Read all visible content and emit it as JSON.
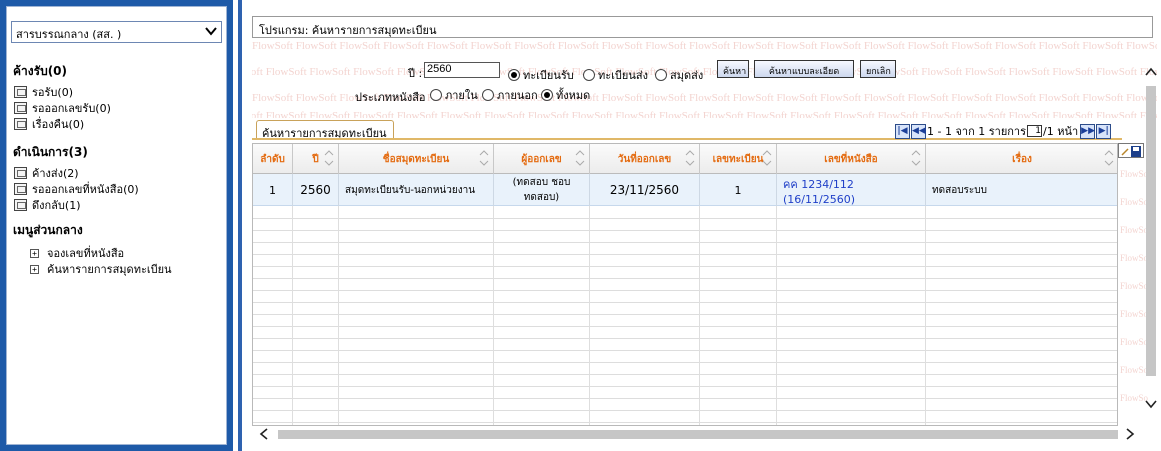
{
  "sidebar": {
    "org_select": "สารบรรณกลาง (สส. )",
    "pending_title": "ค้างรับ(0)",
    "pending_items": [
      "รอรับ(0)",
      "รอออกเลขรับ(0)",
      "เรื่องคืน(0)"
    ],
    "inprogress_title": "ดำเนินการ(3)",
    "inprogress_items": [
      "ค้างส่ง(2)",
      "รอออกเลขที่หนังสือ(0)",
      "ดึงกลับ(1)"
    ],
    "central_title": "เมนูส่วนกลาง",
    "central_items": [
      "จองเลขที่หนังสือ",
      "ค้นหารายการสมุดทะเบียน"
    ]
  },
  "program_label": "โปรแกรม: ค้นหารายการสมุดทะเบียน",
  "watermark": "FlowSoft",
  "search": {
    "year_label": "ปี :",
    "year_value": "2560",
    "register_options": [
      "ทะเบียนรับ",
      "ทะเบียนส่ง",
      "สมุดส่ง"
    ],
    "register_selected": "ทะเบียนรับ",
    "doctype_label": "ประเภทหนังสือ",
    "doctype_options": [
      "ภายใน",
      "ภายนอก",
      "ทั้งหมด"
    ],
    "doctype_selected": "ทั้งหมด",
    "btn_search": "ค้นหา",
    "btn_advanced": "ค้นหาแบบละเอียด",
    "btn_cancel": "ยกเลิก"
  },
  "tab_label": "ค้นหารายการสมุดทะเบียน",
  "pager": {
    "summary": "1 - 1 จาก 1 รายการ",
    "page_input": "1",
    "page_total": "/1 หน้า"
  },
  "table": {
    "columns": [
      "ลำดับ",
      "ปี",
      "ชื่อสมุดทะเบียน",
      "ผู้ออกเลข",
      "วันที่ออกเลข",
      "เลขทะเบียน",
      "เลขที่หนังสือ",
      "เรื่อง"
    ],
    "rows": [
      {
        "no": "1",
        "year": "2560",
        "register_name": "สมุดทะเบียนรับ-นอกหน่วยงาน",
        "issuer": "(ทดสอบ ชอบ ทดสอบ)",
        "issue_date": "23/11/2560",
        "reg_no": "1",
        "doc_no": "คค 1234/112 (16/11/2560)",
        "subject": "ทดสอบระบบ"
      }
    ]
  },
  "colors": {
    "sidebar_blue": "#1e5aa8",
    "header_orange": "#e46c12",
    "row_blue": "#e9f2fb",
    "link_blue": "#1f3fc8"
  }
}
